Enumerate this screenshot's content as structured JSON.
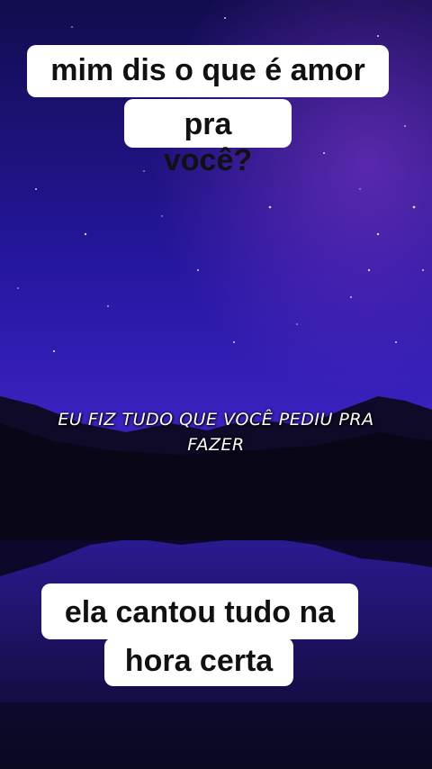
{
  "top_caption": {
    "line1": "mim dis o que é amor",
    "line2": "pra você?"
  },
  "lyrics": {
    "line1": "EU FIZ TUDO QUE VOCÊ PEDIU PRA",
    "line2": "FAZER"
  },
  "bottom_caption": {
    "line1": "ela cantou tudo na",
    "line2": "hora certa"
  },
  "colors": {
    "sky_top": "#1b1170",
    "sky_mid": "#2a1aa0",
    "horizon": "#4a2bb8",
    "mountains": "#0e0a26",
    "water": "#150f4a"
  }
}
